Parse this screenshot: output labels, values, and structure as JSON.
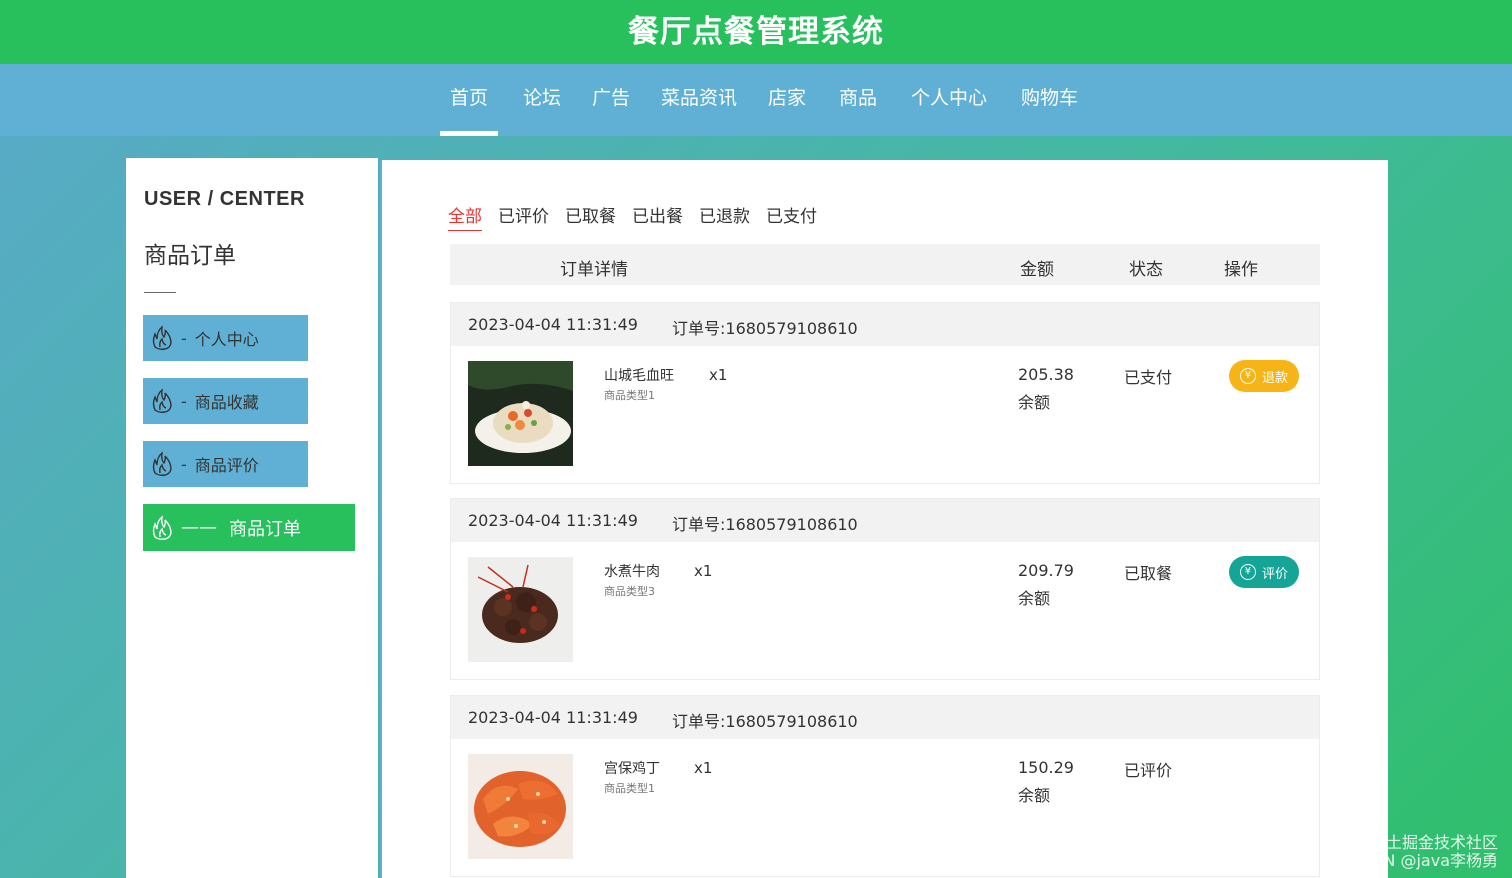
{
  "app_title": "餐厅点餐管理系统",
  "nav": [
    {
      "label": "首页",
      "active": true
    },
    {
      "label": "论坛"
    },
    {
      "label": "广告"
    },
    {
      "label": "菜品资讯"
    },
    {
      "label": "店家"
    },
    {
      "label": "商品"
    },
    {
      "label": "个人中心"
    },
    {
      "label": "购物车"
    }
  ],
  "sidebar": {
    "title": "USER / CENTER",
    "subtitle": "商品订单",
    "menu": [
      {
        "label": "个人中心",
        "dash": "-"
      },
      {
        "label": "商品收藏",
        "dash": "-"
      },
      {
        "label": "商品评价",
        "dash": "-"
      },
      {
        "label": "商品订单",
        "dash": "——",
        "active": true
      }
    ]
  },
  "tabs": [
    {
      "label": "全部",
      "active": true
    },
    {
      "label": "已评价"
    },
    {
      "label": "已取餐"
    },
    {
      "label": "已出餐"
    },
    {
      "label": "已退款"
    },
    {
      "label": "已支付"
    }
  ],
  "table_header": {
    "detail": "订单详情",
    "amount": "金额",
    "status": "状态",
    "action": "操作"
  },
  "orders": [
    {
      "time": "2023-04-04 11:31:49",
      "order_no": "订单号:1680579108610",
      "name": "山城毛血旺",
      "type": "商品类型1",
      "qty": "x1",
      "amount": "205.38",
      "amount_label": "余额",
      "status": "已支付",
      "action": "退款",
      "image": "salad-dish"
    },
    {
      "time": "2023-04-04 11:31:49",
      "order_no": "订单号:1680579108610",
      "name": "水煮牛肉",
      "type": "商品类型3",
      "qty": "x1",
      "amount": "209.79",
      "amount_label": "余额",
      "status": "已取餐",
      "action": "评价",
      "image": "beef-dish"
    },
    {
      "time": "2023-04-04 11:31:49",
      "order_no": "订单号:1680579108610",
      "name": "宫保鸡丁",
      "type": "商品类型1",
      "qty": "x1",
      "amount": "150.29",
      "amount_label": "余额",
      "status": "已评价",
      "image": "shrimp-dish"
    }
  ],
  "yen_symbol": "¥",
  "watermark": {
    "line1": "@稀土掘金技术社区",
    "line2": "CSDN @java李杨勇"
  },
  "colors": {
    "header_green": "#28c05c",
    "nav_blue": "#5fb0d4",
    "refund_button": "#f6b417",
    "review_button": "#14a596",
    "active_tab": "#e33333"
  }
}
